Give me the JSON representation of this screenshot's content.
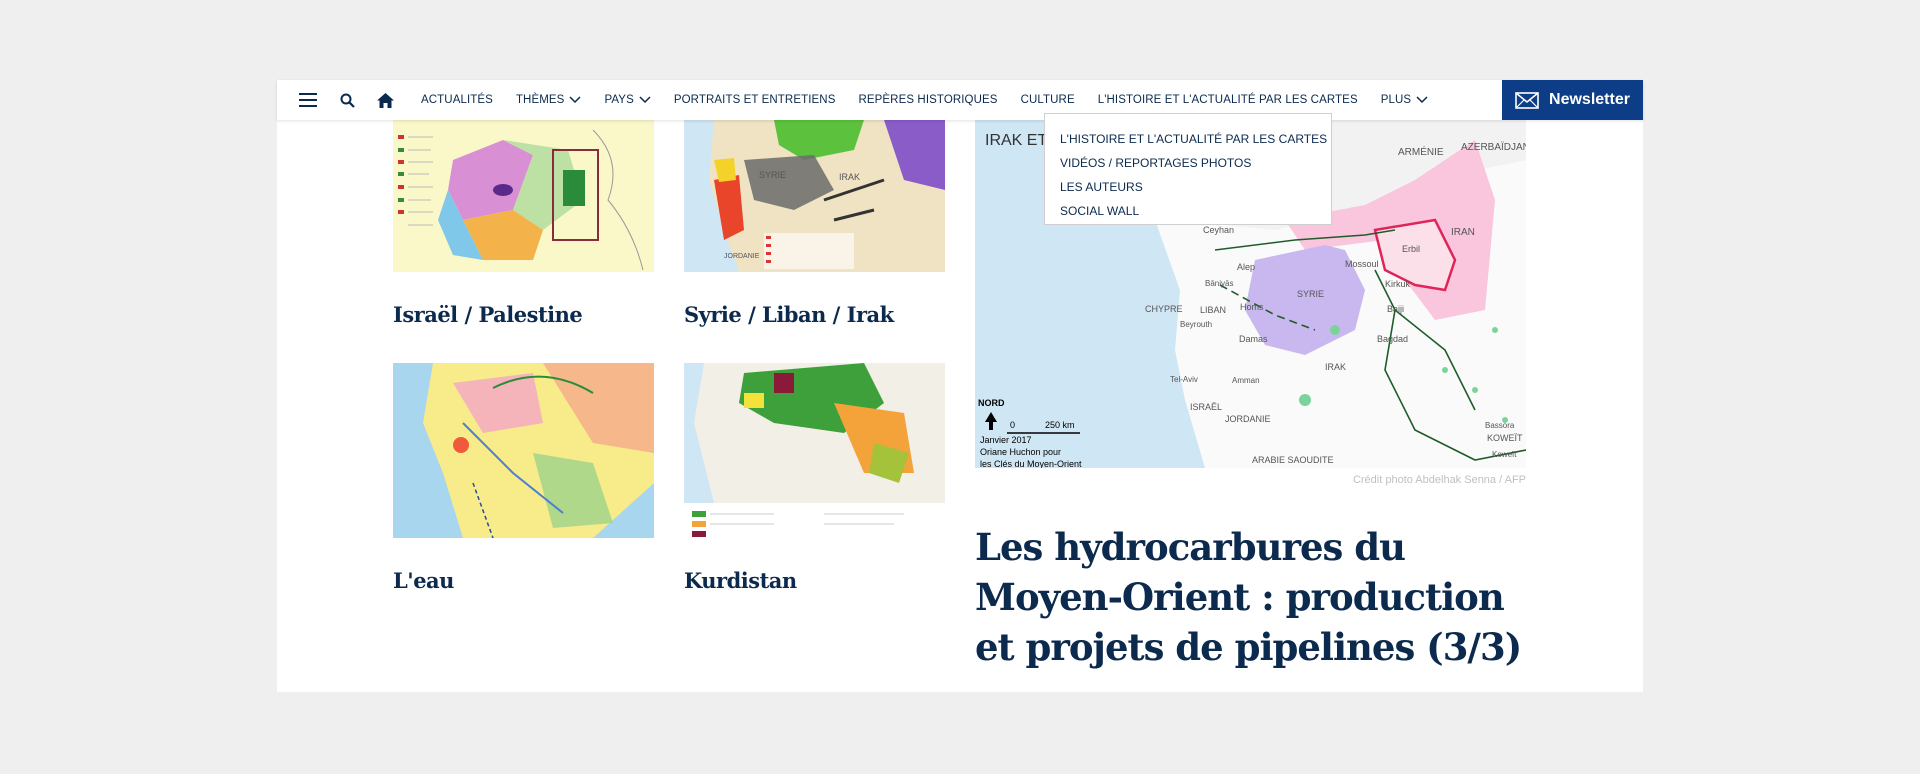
{
  "nav": {
    "links": [
      "ACTUALITÉS",
      "THÈMES",
      "PAYS",
      "PORTRAITS ET ENTRETIENS",
      "REPÈRES HISTORIQUES",
      "CULTURE",
      "L'HISTOIRE ET L'ACTUALITÉ PAR LES CARTES",
      "PLUS"
    ],
    "newsletter_label": "Newsletter"
  },
  "dropdown": {
    "items": [
      "L'HISTOIRE ET L'ACTUALITÉ PAR LES CARTES",
      "VIDÉOS / REPORTAGES PHOTOS",
      "LES AUTEURS",
      "SOCIAL WALL"
    ]
  },
  "cards": [
    {
      "title": "Israël / Palestine"
    },
    {
      "title": "Syrie / Liban / Irak"
    },
    {
      "title": "L'eau"
    },
    {
      "title": "Kurdistan"
    }
  ],
  "featured": {
    "credit": "Crédit photo Abdelhak Senna / AFP",
    "headline": "Les hydrocarbures du Moyen-Orient : production et projets de pipelines (3/3)",
    "map_labels": {
      "title_partial": "IRAK ET T",
      "armenie": "ARMÉNIE",
      "azerbaidjan": "AZERBAÏDJAN",
      "iran": "IRAN",
      "ceyhan": "Ceyhan",
      "erbil": "Erbil",
      "alep": "Alep",
      "mossoul": "Mossoul",
      "kirkuk": "Kirkuk",
      "baniyas": "Bāniyās",
      "syrie": "SYRIE",
      "chypre": "CHYPRE",
      "homs": "Homs",
      "baiji": "Baiji",
      "liban": "LIBAN",
      "beyrouth": "Beyrouth",
      "bagdad": "Bagdad",
      "damas": "Damas",
      "irak": "IRAK",
      "telaviv": "Tel-Aviv",
      "amman": "Amman",
      "israel": "ISRAËL",
      "jordanie": "JORDANIE",
      "bassora": "Bassora",
      "koweit": "KOWEÏT",
      "koweit_city": "Koweït",
      "arabie": "ARABIE SAOUDITE",
      "nord": "NORD",
      "scale_zero": "0",
      "scale_km": "250 km",
      "caption_1": "Janvier 2017",
      "caption_2": "Oriane Huchon pour",
      "caption_3": "les Clés du Moyen-Orient"
    }
  },
  "colors": {
    "accent": "#0c3d86",
    "navy_text": "#0b2a4d"
  }
}
